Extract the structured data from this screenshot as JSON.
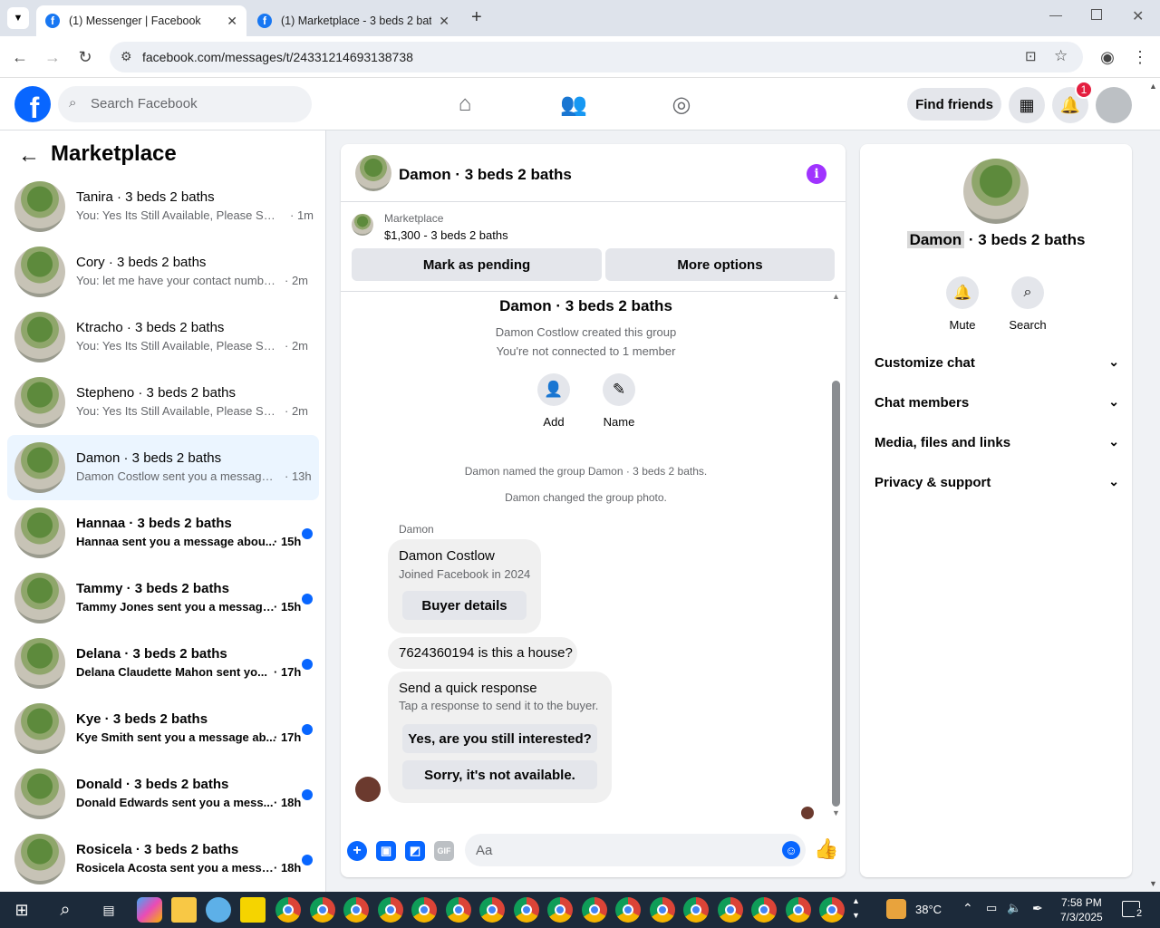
{
  "browser": {
    "tabs": [
      {
        "title": "(1) Messenger | Facebook",
        "active": true
      },
      {
        "title": "(1) Marketplace - 3 beds 2 baths",
        "active": false
      }
    ],
    "url": "facebook.com/messages/t/24331214693138738"
  },
  "header": {
    "logo": "f",
    "search_placeholder": "Search Facebook",
    "find_friends": "Find friends",
    "notif_count": "1"
  },
  "sidebar": {
    "title": "Marketplace",
    "conversations": [
      {
        "name": "Tanira · 3 beds 2 baths",
        "preview": "You: Yes Its Still Available, Please Sen...",
        "time": "· 1m",
        "unread": false,
        "selected": false
      },
      {
        "name": "Cory · 3 beds 2 baths",
        "preview": "You: let me have your contact numbe...",
        "time": "· 2m",
        "unread": false,
        "selected": false
      },
      {
        "name": "Ktracho · 3 beds 2 baths",
        "preview": "You: Yes Its Still Available, Please Sen...",
        "time": "· 2m",
        "unread": false,
        "selected": false
      },
      {
        "name": "Stepheno · 3 beds 2 baths",
        "preview": "You: Yes Its Still Available, Please Sen...",
        "time": "· 2m",
        "unread": false,
        "selected": false
      },
      {
        "name": "Damon · 3 beds 2 baths",
        "preview": "Damon Costlow sent you a message ...",
        "time": "· 13h",
        "unread": false,
        "selected": true
      },
      {
        "name": "Hannaa · 3 beds 2 baths",
        "preview": "Hannaa sent you a message abou...",
        "time": "· 15h",
        "unread": true,
        "selected": false
      },
      {
        "name": "Tammy · 3 beds 2 baths",
        "preview": "Tammy Jones sent you a message...",
        "time": "· 15h",
        "unread": true,
        "selected": false
      },
      {
        "name": "Delana · 3 beds 2 baths",
        "preview": "Delana Claudette Mahon sent yo...",
        "time": "· 17h",
        "unread": true,
        "selected": false
      },
      {
        "name": "Kye · 3 beds 2 baths",
        "preview": "Kye Smith sent you a message ab...",
        "time": "· 17h",
        "unread": true,
        "selected": false
      },
      {
        "name": "Donald · 3 beds 2 baths",
        "preview": "Donald Edwards sent you a mess...",
        "time": "· 18h",
        "unread": true,
        "selected": false
      },
      {
        "name": "Rosicela · 3 beds 2 baths",
        "preview": "Rosicela Acosta sent you a messa...",
        "time": "· 18h",
        "unread": true,
        "selected": false
      }
    ]
  },
  "chat": {
    "title": "Damon · 3 beds 2 baths",
    "marketplace_label": "Marketplace",
    "listing": "$1,300 - 3 beds 2 baths",
    "mark_pending": "Mark as pending",
    "more_options": "More options",
    "group_title": "Damon · 3 beds 2 baths",
    "created": "Damon Costlow created this group",
    "not_connected": "You're not connected to 1 member",
    "add_label": "Add",
    "name_label": "Name",
    "event1": "Damon named the group Damon · 3 beds 2 baths.",
    "event2": "Damon changed the group photo.",
    "sender": "Damon",
    "card_name": "Damon Costlow",
    "card_sub": "Joined Facebook in 2024",
    "buyer_details": "Buyer details",
    "message": "7624360194 is this a house?",
    "quick_title": "Send a quick response",
    "quick_sub": "Tap a response to send it to the buyer.",
    "quick1": "Yes, are you still interested?",
    "quick2": "Sorry, it's not available.",
    "input_placeholder": "Aa",
    "gif_label": "GIF"
  },
  "details": {
    "name_highlight": "Damon",
    "name_rest": " · 3 beds 2 baths",
    "mute": "Mute",
    "search": "Search",
    "sections": [
      "Customize chat",
      "Chat members",
      "Media, files and links",
      "Privacy & support"
    ]
  },
  "taskbar": {
    "temp": "38°C",
    "time": "7:58 PM",
    "date": "7/3/2025",
    "notif": "2"
  }
}
